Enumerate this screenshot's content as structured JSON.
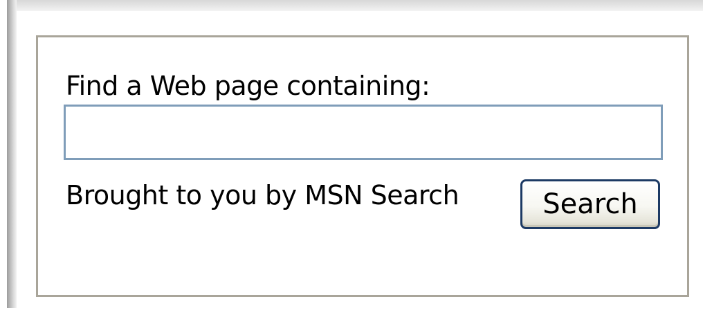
{
  "search_box": {
    "label": "Find a Web page containing:",
    "input_value": "",
    "attribution": "Brought to you by MSN Search",
    "button_label": "Search"
  }
}
